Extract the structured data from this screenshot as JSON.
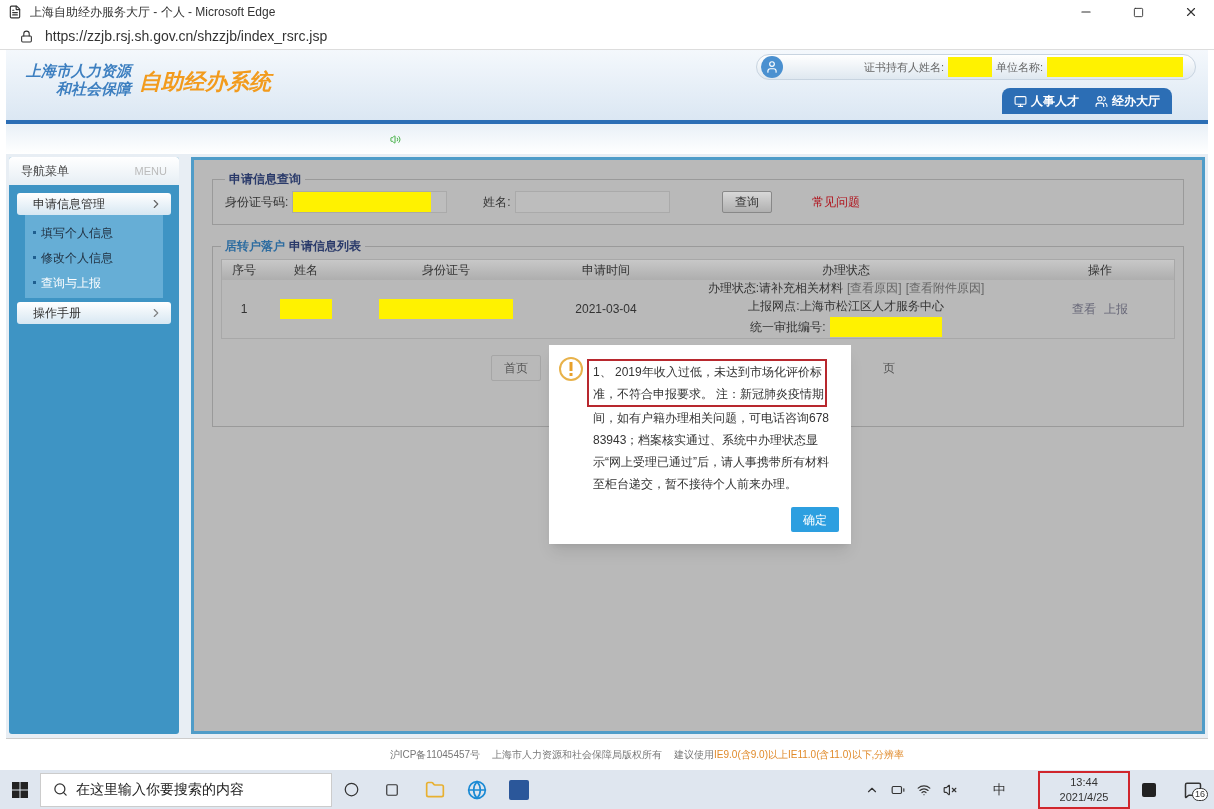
{
  "window": {
    "title": "上海自助经办服务大厅 - 个人 - Microsoft Edge"
  },
  "address_bar": {
    "url": "https://zzjb.rsj.sh.gov.cn/shzzjb/index_rsrc.jsp"
  },
  "header": {
    "logo_line_1": "上海市人力资源",
    "logo_line_2": "和社会保障",
    "system_name": "自助经办系统",
    "holder_label": "证书持有人姓名:",
    "unit_label": "单位名称:",
    "tabs": [
      {
        "label": "人事人才",
        "kind": "people"
      },
      {
        "label": "经办大厅",
        "kind": "hall"
      }
    ]
  },
  "sidebar": {
    "title": "导航菜单",
    "title_en": "MENU",
    "sections": [
      {
        "label": "申请信息管理",
        "expanded": true,
        "children": [
          {
            "label": "填写个人信息",
            "selected": false
          },
          {
            "label": "修改个人信息",
            "selected": false
          },
          {
            "label": "查询与上报",
            "selected": true
          }
        ]
      },
      {
        "label": "操作手册",
        "expanded": false
      }
    ]
  },
  "query": {
    "legend": "申请信息查询",
    "id_label": "身份证号码:",
    "name_label": "姓名:",
    "button": "查询",
    "faq_link": "常见问题"
  },
  "list": {
    "legend_prefix": "居转户落户",
    "legend": "申请信息列表",
    "columns": [
      "序号",
      "姓名",
      "身份证号",
      "申请时间",
      "办理状态",
      "操作"
    ],
    "rows": [
      {
        "index": "1",
        "date": "2021-03-04",
        "status_label": "办理状态:",
        "status": "请补充相关材料",
        "status_links": [
          "[查看原因]",
          "[查看附件原因]"
        ],
        "office_label": "上报网点:",
        "office": "上海市松江区人才服务中心",
        "approval_label": "统一审批编号:",
        "actions": [
          "查看",
          "上报"
        ]
      }
    ],
    "pagination": [
      "首页",
      "页"
    ]
  },
  "dialog": {
    "message": [
      {
        "text": "1、 2019年收入过低，未达到市场化评价标准，不符合申报要求。 注：新冠肺炎疫情期",
        "highlighted": true
      },
      {
        "text": "间，如有户籍办理相关问题，可电话咨询67883943；档案核实通过、系统中办理状态显示“网上受理已通过”后，请人事携带所有材料至柜台递交，暂不接待个人前来办理。",
        "highlighted": false
      }
    ],
    "button": "确定"
  },
  "footer": {
    "icp": "沪ICP备11045457号",
    "copyright": "上海市人力资源和社会保障局版权所有",
    "advice_prefix": "建议使用",
    "advice": "IE9.0(含9.0)以上IE11.0(含11.0)以下,分辨率"
  },
  "taskbar": {
    "search_placeholder": "在这里输入你要搜索的内容",
    "ime": "中",
    "time": "13:44",
    "date": "2021/4/25",
    "notification_count": "16"
  }
}
